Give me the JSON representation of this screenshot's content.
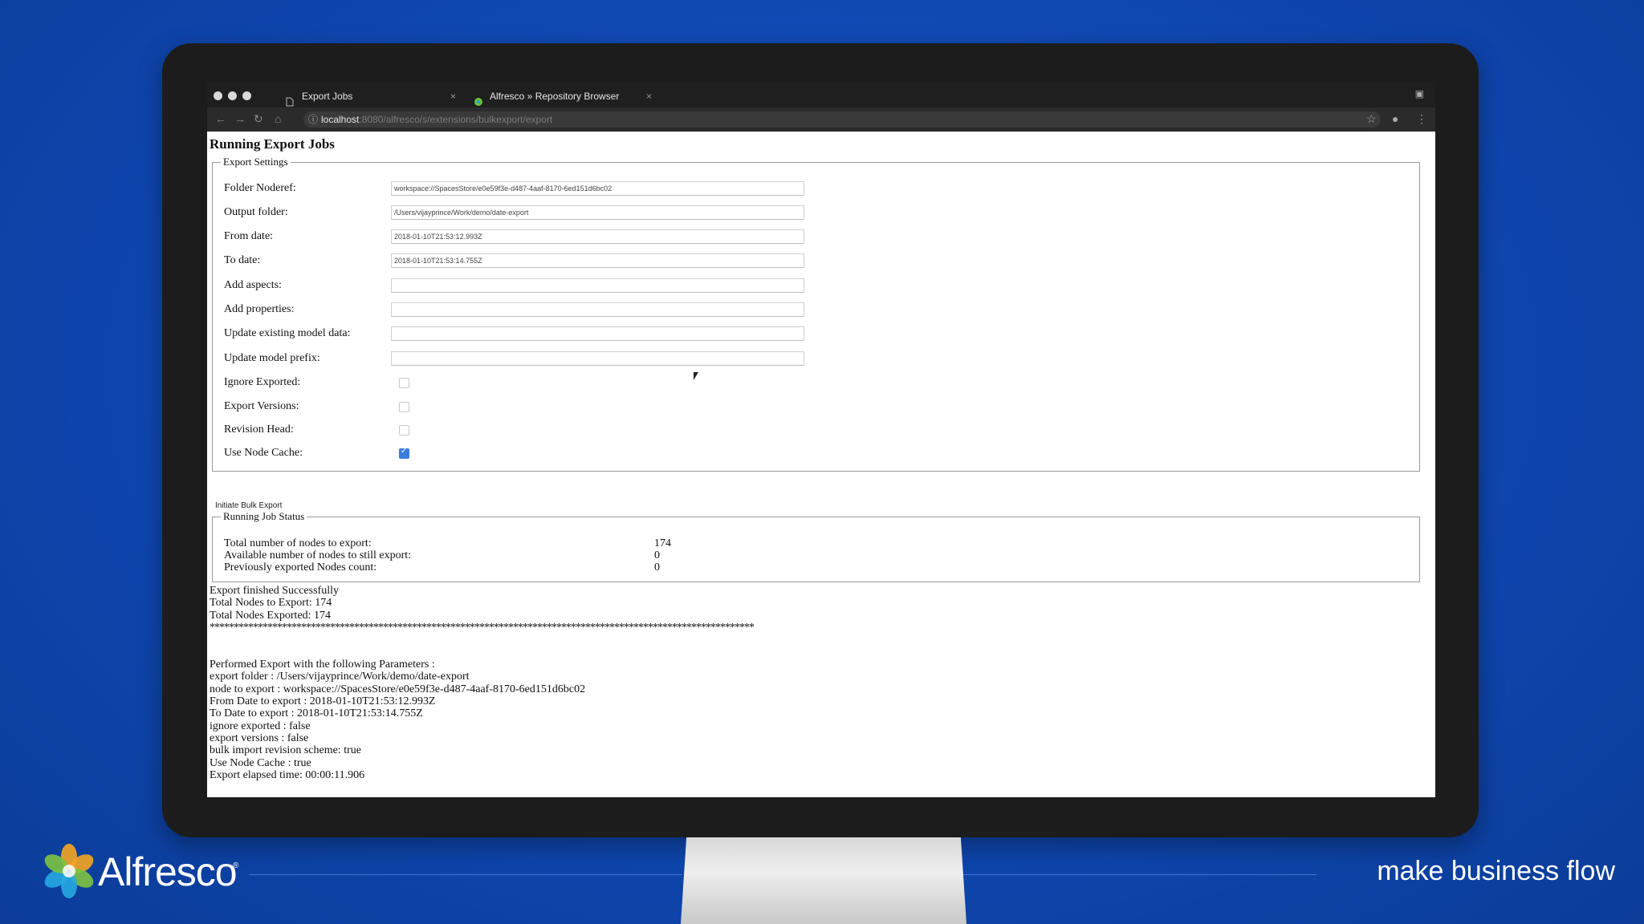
{
  "browser": {
    "tabs": [
      {
        "label": "Export Jobs"
      },
      {
        "label": "Alfresco » Repository Browser"
      }
    ],
    "url_host": "localhost",
    "url_path": ":8080/alfresco/s/extensions/bulkexport/export"
  },
  "page": {
    "title": "Running Export Jobs",
    "settings_legend": "Export Settings",
    "fields": [
      {
        "label": "Folder Noderef:",
        "value": "workspace://SpacesStore/e0e59f3e-d487-4aaf-8170-6ed151d6bc02"
      },
      {
        "label": "Output folder:",
        "value": "/Users/vijayprince/Work/demo/date-export"
      },
      {
        "label": "From date:",
        "value": "2018-01-10T21:53:12.993Z"
      },
      {
        "label": "To date:",
        "value": "2018-01-10T21:53:14.755Z"
      },
      {
        "label": "Add aspects:",
        "value": ""
      },
      {
        "label": "Add properties:",
        "value": ""
      },
      {
        "label": "Update existing model data:",
        "value": ""
      },
      {
        "label": "Update model prefix:",
        "value": ""
      }
    ],
    "checkboxes": [
      {
        "label": "Ignore Exported:",
        "checked": false
      },
      {
        "label": "Export Versions:",
        "checked": false
      },
      {
        "label": "Revision Head:",
        "checked": false
      },
      {
        "label": "Use Node Cache:",
        "checked": true
      }
    ],
    "initiate_button": "Initiate Bulk Export",
    "status_legend": "Running Job Status",
    "status_rows": [
      {
        "label": "Total number of nodes to export:",
        "value": "174"
      },
      {
        "label": "Available number of nodes to still export:",
        "value": "0"
      },
      {
        "label": "Previously exported Nodes count:",
        "value": "0"
      }
    ],
    "log_lines": [
      "Export finished Successfully",
      "Total Nodes to Export: 174",
      "Total Nodes Exported: 174",
      "*****************************************************************************************************************",
      "",
      "Performed Export with the following Parameters :",
      "export folder : /Users/vijayprince/Work/demo/date-export",
      "node to export : workspace://SpacesStore/e0e59f3e-d487-4aaf-8170-6ed151d6bc02",
      "From Date to export : 2018-01-10T21:53:12.993Z",
      "To Date to export : 2018-01-10T21:53:14.755Z",
      "ignore exported : false",
      "export versions : false",
      "bulk import revision scheme: true",
      "Use Node Cache : true",
      "Export elapsed time: 00:00:11.906"
    ]
  },
  "brand": {
    "logo_text": "Alfresco",
    "tagline": "make business flow",
    "colors": {
      "background": "#0f47b0",
      "logo_orange": "#f5a623",
      "logo_green": "#7cc242",
      "logo_blue": "#27a9e1"
    }
  }
}
